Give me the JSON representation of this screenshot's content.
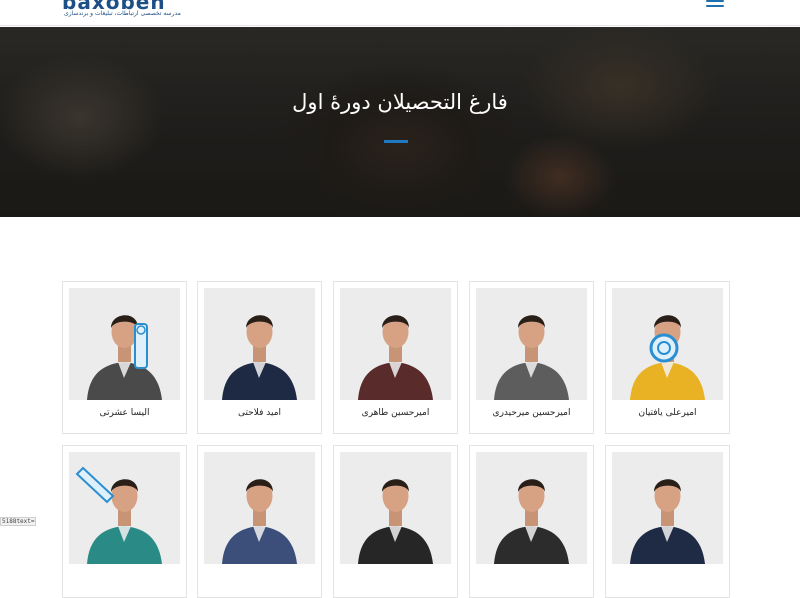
{
  "header": {
    "logo_word": "baxoben",
    "logo_tagline": "مدرسه تخصصی ارتباطات، تبلیغات و برندسازی"
  },
  "hero": {
    "title": "فارغ التحصیلان دورهٔ اول"
  },
  "graduates": [
    {
      "name": "امیرعلی یافتیان",
      "shirt": "#e9b224",
      "bg": "#ececec",
      "prop": "circle-sign"
    },
    {
      "name": "امیرحسین میرحیدری",
      "shirt": "#5d5d5d",
      "bg": "#ececec",
      "prop": "none"
    },
    {
      "name": "امیرحسین طاهری",
      "shirt": "#5a2b2b",
      "bg": "#ececec",
      "prop": "none"
    },
    {
      "name": "امید فلاحتی",
      "shirt": "#1e2a44",
      "bg": "#ececec",
      "prop": "none"
    },
    {
      "name": "الیسا عشرتی",
      "shirt": "#4a4a4a",
      "bg": "#ececec",
      "prop": "pawn-sign"
    },
    {
      "name": "",
      "shirt": "#1f2b45",
      "bg": "#ececec",
      "prop": "none"
    },
    {
      "name": "",
      "shirt": "#2c2c2c",
      "bg": "#ececec",
      "prop": "none"
    },
    {
      "name": "",
      "shirt": "#262626",
      "bg": "#ececec",
      "prop": "none"
    },
    {
      "name": "",
      "shirt": "#3b4f7a",
      "bg": "#ececec",
      "prop": "none"
    },
    {
      "name": "",
      "shirt": "#2a8a86",
      "bg": "#ececec",
      "prop": "pencil-sign"
    }
  ],
  "status_bar": {
    "text": "5188text="
  },
  "colors": {
    "brand_blue": "#1d4f86",
    "accent_blue": "#1e79c2"
  }
}
